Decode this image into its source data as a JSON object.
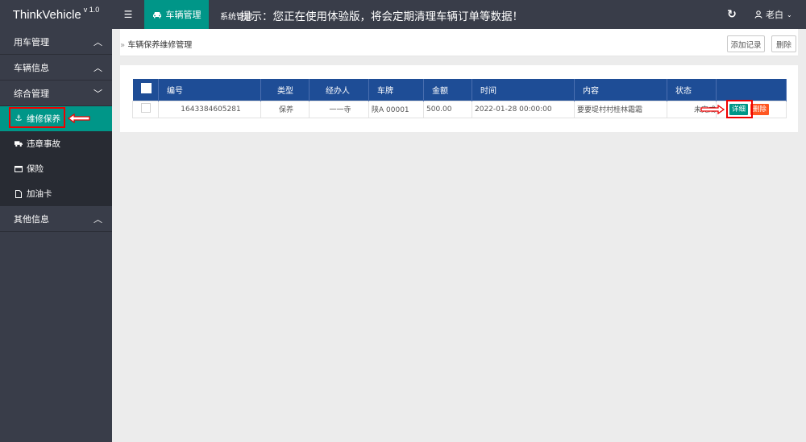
{
  "header": {
    "app_name": "ThinkVehicle",
    "version": "v 1.0",
    "menu_icon": "menu-icon",
    "active_tab": "车辆管理",
    "active_tab_icon": "car-icon",
    "second_tab": "系统管理",
    "notice": "提示：您正在使用体验版，将会定期清理车辆订单等数据！",
    "user_name": "老白"
  },
  "sidebar": {
    "groups": [
      {
        "label": "用车管理"
      },
      {
        "label": "车辆信息"
      },
      {
        "label": "综合管理"
      }
    ],
    "sub_items": [
      {
        "label": "维修保养",
        "icon": "anchor-icon"
      },
      {
        "label": "违章事故",
        "icon": "truck-icon"
      },
      {
        "label": "保险",
        "icon": "card-icon"
      },
      {
        "label": "加油卡",
        "icon": "file-icon"
      }
    ],
    "last_group": {
      "label": "其他信息"
    }
  },
  "breadcrumb": "车辆保养维修管理",
  "toolbar": {
    "add_label": "添加记录",
    "delete_label": "删除"
  },
  "table": {
    "headers": [
      "编号",
      "类型",
      "经办人",
      "车牌",
      "金额",
      "时间",
      "内容",
      "状态"
    ],
    "rows": [
      {
        "id": "1643384605281",
        "type": "保养",
        "handler": "一一寺",
        "plate": "陕A 00001",
        "amount": "500.00",
        "time": "2022-01-28 00:00:00",
        "content": "要要堤村村桂林霜霜",
        "status": "未完成",
        "detail_label": "详细",
        "delete_label": "删除"
      }
    ]
  },
  "colors": {
    "topbar": "#393d49",
    "accent": "#009688",
    "table_header": "#1e4d96",
    "danger": "#ff5722",
    "highlight": "#e00000"
  }
}
